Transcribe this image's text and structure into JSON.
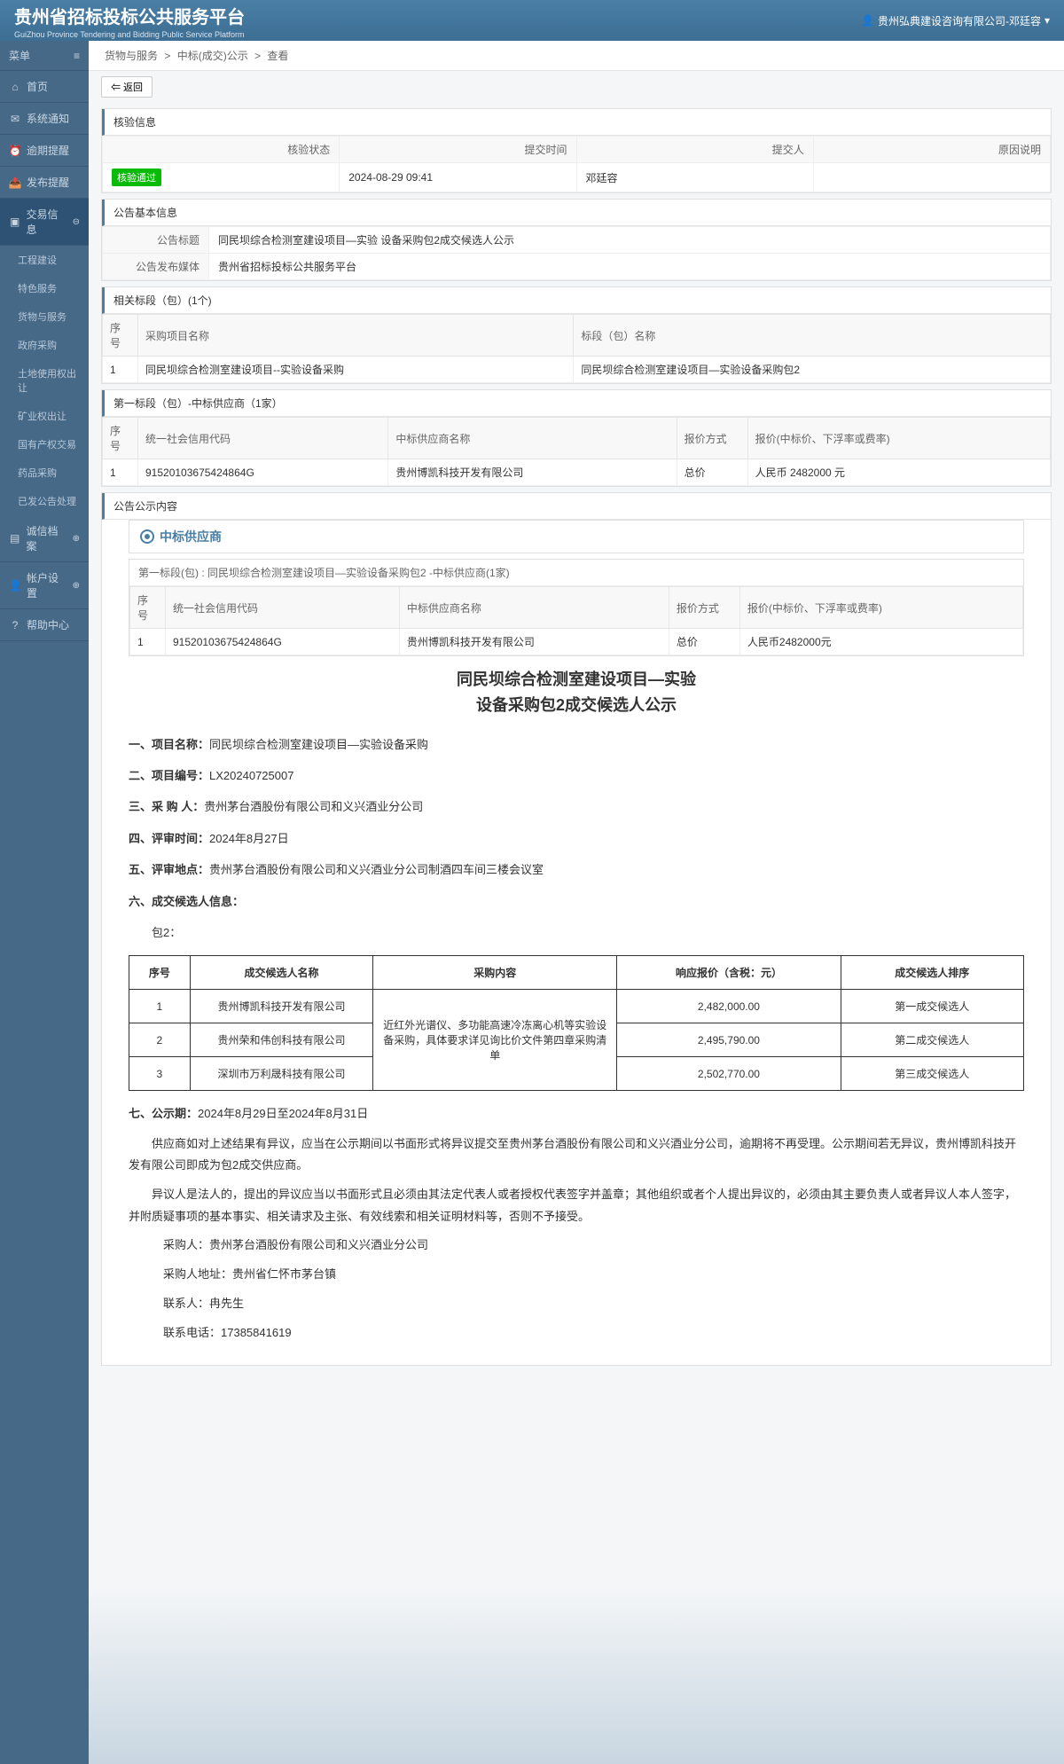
{
  "header": {
    "title": "贵州省招标投标公共服务平台",
    "title_en": "GuiZhou Province Tendering and Bidding Public Service Platform",
    "user": "贵州弘典建设咨询有限公司-邓廷容"
  },
  "sidebar": {
    "menu_label": "菜单",
    "items": [
      {
        "icon": "home",
        "label": "首页"
      },
      {
        "icon": "bell",
        "label": "系统通知"
      },
      {
        "icon": "clock",
        "label": "逾期提醒"
      },
      {
        "icon": "send",
        "label": "发布提醒"
      },
      {
        "icon": "list",
        "label": "交易信息",
        "active": true,
        "expand": true
      },
      {
        "icon": "file",
        "label": "诚信档案",
        "expand": true
      },
      {
        "icon": "user",
        "label": "帐户设置",
        "expand": true
      },
      {
        "icon": "help",
        "label": "帮助中心"
      }
    ],
    "submenu": [
      "工程建设",
      "特色服务",
      "货物与服务",
      "政府采购",
      "土地使用权出让",
      "矿业权出让",
      "国有产权交易",
      "药品采购",
      "已发公告处理"
    ]
  },
  "breadcrumb": {
    "a": "货物与服务",
    "b": "中标(成交)公示",
    "c": "查看"
  },
  "back_btn": "⇐ 返回",
  "verify": {
    "title": "核验信息",
    "headers": {
      "status": "核验状态",
      "time": "提交时间",
      "person": "提交人",
      "reason": "原因说明"
    },
    "status": "核验通过",
    "time": "2024-08-29 09:41",
    "person": "邓廷容",
    "reason": ""
  },
  "basic": {
    "title": "公告基本信息",
    "labels": {
      "title": "公告标题",
      "media": "公告发布媒体"
    },
    "announcement_title": "同民坝综合检测室建设项目—实验 设备采购包2成交候选人公示",
    "media": "贵州省招标投标公共服务平台"
  },
  "related": {
    "title": "相关标段（包）(1个)",
    "headers": {
      "no": "序号",
      "project": "采购项目名称",
      "section": "标段（包）名称"
    },
    "rows": [
      {
        "no": "1",
        "project": "同民坝综合检测室建设项目--实验设备采购",
        "section": "同民坝综合检测室建设项目—实验设备采购包2"
      }
    ]
  },
  "supplier": {
    "title": "第一标段（包）-中标供应商（1家）",
    "headers": {
      "no": "序号",
      "code": "统一社会信用代码",
      "name": "中标供应商名称",
      "method": "报价方式",
      "price": "报价(中标价、下浮率或费率)"
    },
    "rows": [
      {
        "no": "1",
        "code": "91520103675424864G",
        "name": "贵州博凯科技开发有限公司",
        "method": "总价",
        "price": "人民币 2482000 元"
      }
    ]
  },
  "content": {
    "title": "公告公示内容",
    "bidder_label": "中标供应商",
    "section_label": "第一标段(包) : 同民坝综合检测室建设项目—实验设备采购包2 -中标供应商(1家)",
    "inner_table": {
      "headers": {
        "no": "序号",
        "code": "统一社会信用代码",
        "name": "中标供应商名称",
        "method": "报价方式",
        "price": "报价(中标价、下浮率或费率)"
      },
      "row": {
        "no": "1",
        "code": "91520103675424864G",
        "name": "贵州博凯科技开发有限公司",
        "method": "总价",
        "price": "人民币2482000元"
      }
    }
  },
  "announcement": {
    "main_title_1": "同民坝综合检测室建设项目—实验",
    "main_title_2": "设备采购包2成交候选人公示",
    "fields": {
      "f1_label": "一、项目名称：",
      "f1": "同民坝综合检测室建设项目—实验设备采购",
      "f2_label": "二、项目编号：",
      "f2": "LX20240725007",
      "f3_label": "三、采 购 人：",
      "f3": "贵州茅台酒股份有限公司和义兴酒业分公司",
      "f4_label": "四、评审时间：",
      "f4": "2024年8月27日",
      "f5_label": "五、评审地点：",
      "f5": "贵州茅台酒股份有限公司和义兴酒业分公司制酒四车间三楼会议室",
      "f6_label": "六、成交候选人信息："
    },
    "pkg_label": "包2：",
    "candidate_headers": {
      "no": "序号",
      "name": "成交候选人名称",
      "content": "采购内容",
      "price": "响应报价（含税：元）",
      "rank": "成交候选人排序"
    },
    "candidates": [
      {
        "no": "1",
        "name": "贵州博凯科技开发有限公司",
        "price": "2,482,000.00",
        "rank": "第一成交候选人"
      },
      {
        "no": "2",
        "name": "贵州荣和伟创科技有限公司",
        "price": "2,495,790.00",
        "rank": "第二成交候选人"
      },
      {
        "no": "3",
        "name": "深圳市万利晟科技有限公司",
        "price": "2,502,770.00",
        "rank": "第三成交候选人"
      }
    ],
    "purchase_content": "近红外光谱仪、多功能高速冷冻离心机等实验设备采购，具体要求详见询比价文件第四章采购清单",
    "period_label": "七、公示期：",
    "period": "2024年8月29日至2024年8月31日",
    "para1": "供应商如对上述结果有异议，应当在公示期间以书面形式将异议提交至贵州茅台酒股份有限公司和义兴酒业分公司，逾期将不再受理。公示期间若无异议，贵州博凯科技开发有限公司即成为包2成交供应商。",
    "para2": "异议人是法人的，提出的异议应当以书面形式且必须由其法定代表人或者授权代表签字并盖章；其他组织或者个人提出异议的，必须由其主要负责人或者异议人本人签字，并附质疑事项的基本事实、相关请求及主张、有效线索和相关证明材料等，否则不予接受。",
    "footer": {
      "buyer_label": "采购人：",
      "buyer": "贵州茅台酒股份有限公司和义兴酒业分公司",
      "addr_label": "采购人地址：",
      "addr": "贵州省仁怀市茅台镇",
      "contact_label": "联系人：",
      "contact": "冉先生",
      "phone_label": "联系电话：",
      "phone": "17385841619"
    }
  }
}
